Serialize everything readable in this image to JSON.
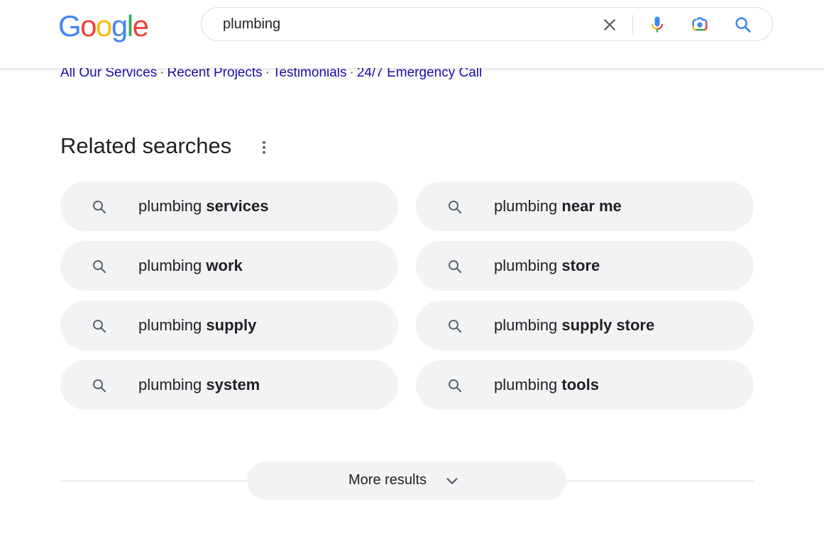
{
  "header": {
    "logo": [
      "G",
      "o",
      "o",
      "g",
      "l",
      "e"
    ],
    "logo_colors": [
      "#4285f4",
      "#ea4335",
      "#fbbc05",
      "#4285f4",
      "#34a853",
      "#ea4335"
    ],
    "search_value": "plumbing",
    "icons": {
      "clear": "close-icon",
      "voice": "microphone-icon",
      "lens": "camera-lens-icon",
      "search": "search-icon"
    }
  },
  "sitelinks": [
    "All Our Services",
    "Recent Projects",
    "Testimonials",
    "24/7 Emergency Call"
  ],
  "sitelinks_separator": "·",
  "related": {
    "title": "Related searches",
    "items": [
      {
        "prefix": "plumbing",
        "bold": "services"
      },
      {
        "prefix": "plumbing",
        "bold": "near me"
      },
      {
        "prefix": "plumbing",
        "bold": "work"
      },
      {
        "prefix": "plumbing",
        "bold": "store"
      },
      {
        "prefix": "plumbing",
        "bold": "supply"
      },
      {
        "prefix": "plumbing",
        "bold": "supply store"
      },
      {
        "prefix": "plumbing",
        "bold": "system"
      },
      {
        "prefix": "plumbing",
        "bold": "tools"
      }
    ]
  },
  "more_results": {
    "label": "More results"
  },
  "colors": {
    "link": "#1a0dab",
    "chip_bg": "#f1f3f4",
    "search_blue": "#4285f4"
  }
}
